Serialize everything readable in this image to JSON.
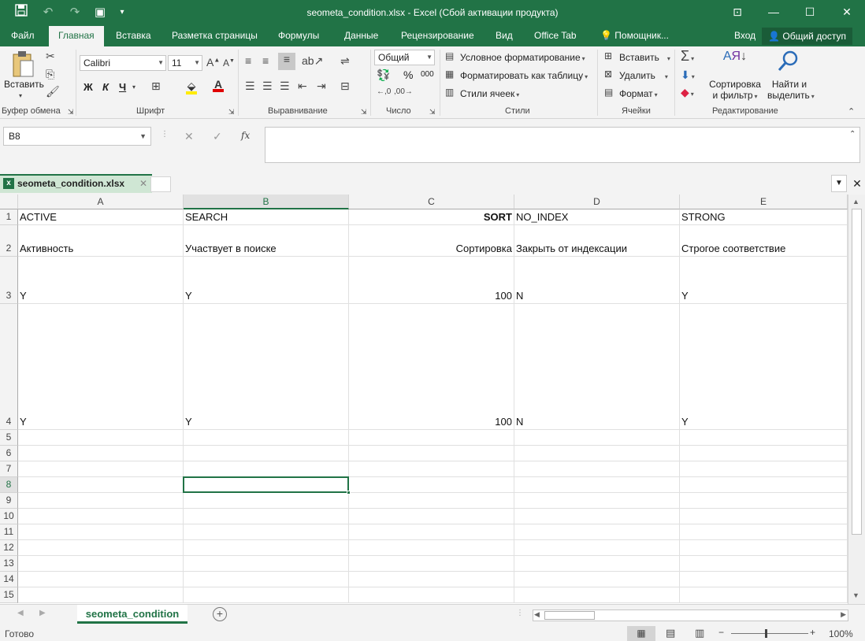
{
  "window": {
    "title": "seometa_condition.xlsx - Excel (Сбой активации продукта)"
  },
  "ribbon_tabs": [
    "Файл",
    "Главная",
    "Вставка",
    "Разметка страницы",
    "Формулы",
    "Данные",
    "Рецензирование",
    "Вид",
    "Office Tab"
  ],
  "tell_me": "Помощник...",
  "signin": "Вход",
  "share": "Общий доступ",
  "ribbon": {
    "clipboard": {
      "paste": "Вставить",
      "label": "Буфер обмена"
    },
    "font": {
      "name": "Calibri",
      "size": "11",
      "bold": "Ж",
      "italic": "К",
      "underline": "Ч",
      "label": "Шрифт"
    },
    "alignment": {
      "label": "Выравнивание"
    },
    "number": {
      "format": "Общий",
      "percent": "%",
      "thousands": "000",
      "label": "Число"
    },
    "styles": {
      "conditional": "Условное форматирование",
      "as_table": "Форматировать как таблицу",
      "cell_styles": "Стили ячеек",
      "label": "Стили"
    },
    "cells": {
      "insert": "Вставить",
      "delete": "Удалить",
      "format": "Формат",
      "label": "Ячейки"
    },
    "editing": {
      "sort_line1": "Сортировка",
      "sort_line2": "и фильтр",
      "find_line1": "Найти и",
      "find_line2": "выделить",
      "label": "Редактирование"
    }
  },
  "formula_bar": {
    "name_box": "B8",
    "formula": "",
    "fx": "fx"
  },
  "doc_tab": "seometa_condition.xlsx",
  "columns": [
    "A",
    "B",
    "C",
    "D",
    "E"
  ],
  "rows": [
    "1",
    "2",
    "3",
    "4",
    "5",
    "6",
    "7",
    "8",
    "9",
    "10",
    "11",
    "12",
    "13",
    "14",
    "15"
  ],
  "cells": {
    "r1": [
      "ACTIVE",
      "SEARCH",
      "SORT",
      "NO_INDEX",
      "STRONG"
    ],
    "r2": [
      "Активность",
      "Участвует в поиске",
      "Сортировка",
      "Закрыть от индексации",
      "Строгое соответствие"
    ],
    "r3": [
      "Y",
      "Y",
      "100",
      "N",
      "Y"
    ],
    "r4": [
      "Y",
      "Y",
      "100",
      "N",
      "Y"
    ]
  },
  "selected_cell": "B8",
  "sheet_tab": "seometa_condition",
  "status": {
    "ready": "Готово",
    "zoom": "100%"
  }
}
